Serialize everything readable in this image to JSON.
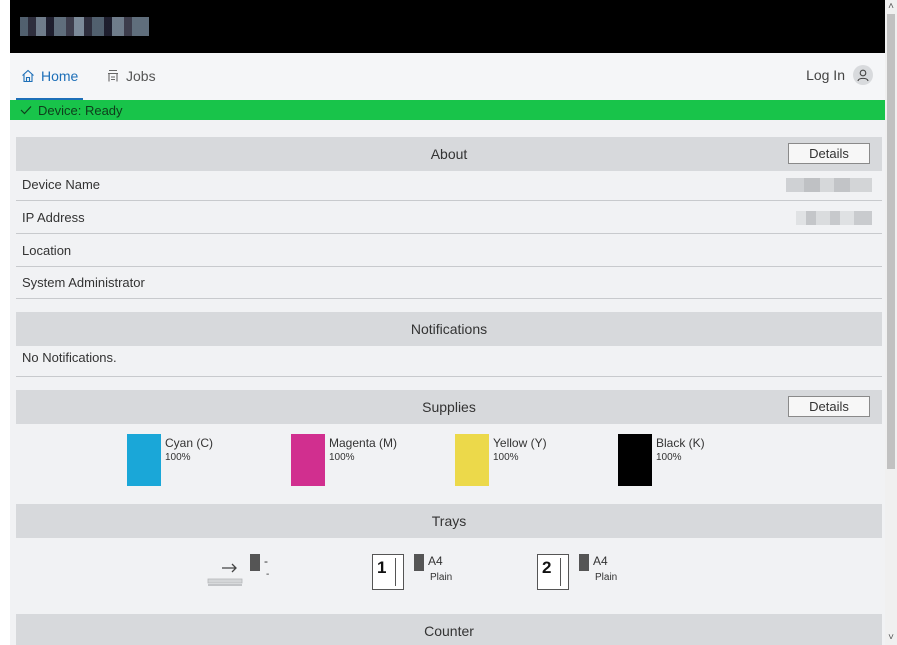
{
  "nav": {
    "tabs": [
      {
        "label": "Home",
        "icon": "home-icon",
        "active": true
      },
      {
        "label": "Jobs",
        "icon": "printer-icon",
        "active": false
      }
    ],
    "login_label": "Log In"
  },
  "status": {
    "text": "Device: Ready",
    "color": "#18c44a"
  },
  "about": {
    "title": "About",
    "details_label": "Details",
    "rows": [
      {
        "label": "Device Name"
      },
      {
        "label": "IP Address"
      },
      {
        "label": "Location"
      },
      {
        "label": "System Administrator"
      }
    ]
  },
  "notifications": {
    "title": "Notifications",
    "empty_text": "No Notifications."
  },
  "supplies": {
    "title": "Supplies",
    "details_label": "Details",
    "items": [
      {
        "name": "Cyan (C)",
        "level": "100%",
        "color": "#1aa7d8"
      },
      {
        "name": "Magenta (M)",
        "level": "100%",
        "color": "#d12f8f"
      },
      {
        "name": "Yellow (Y)",
        "level": "100%",
        "color": "#ecd94a"
      },
      {
        "name": "Black (K)",
        "level": "100%",
        "color": "#000000"
      }
    ]
  },
  "trays": {
    "title": "Trays",
    "items": [
      {
        "id": "bypass",
        "size": "-",
        "type": "-"
      },
      {
        "id": "1",
        "size": "A4",
        "type": "Plain"
      },
      {
        "id": "2",
        "size": "A4",
        "type": "Plain"
      }
    ]
  },
  "counter": {
    "title": "Counter"
  }
}
